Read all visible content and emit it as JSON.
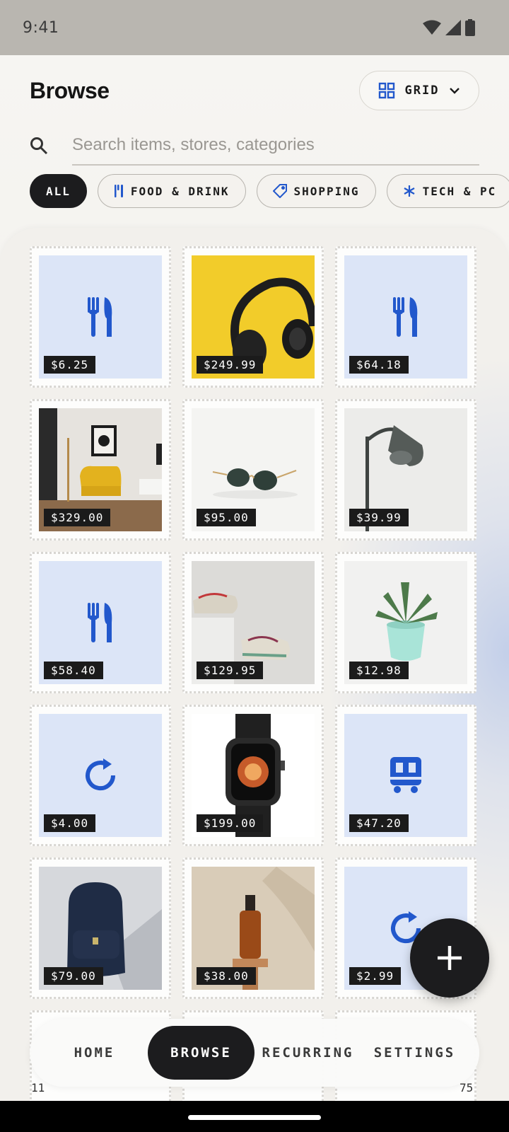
{
  "status_bar": {
    "time": "9:41"
  },
  "header": {
    "title": "Browse",
    "view_toggle_label": "GRID"
  },
  "search": {
    "placeholder": "Search items, stores, categories"
  },
  "chips": [
    {
      "label": "ALL",
      "icon": ""
    },
    {
      "label": "FOOD & DRINK",
      "icon": "fork-knife-icon"
    },
    {
      "label": "SHOPPING",
      "icon": "tag-icon"
    },
    {
      "label": "TECH & PC",
      "icon": "asterisk-icon"
    }
  ],
  "items": [
    {
      "price": "$6.25",
      "kind": "food"
    },
    {
      "price": "$249.99",
      "kind": "headphones"
    },
    {
      "price": "$64.18",
      "kind": "food"
    },
    {
      "price": "$329.00",
      "kind": "armchair"
    },
    {
      "price": "$95.00",
      "kind": "sunglasses"
    },
    {
      "price": "$39.99",
      "kind": "lamp"
    },
    {
      "price": "$58.40",
      "kind": "food"
    },
    {
      "price": "$129.95",
      "kind": "sneakers"
    },
    {
      "price": "$12.98",
      "kind": "plant"
    },
    {
      "price": "$4.00",
      "kind": "recurring"
    },
    {
      "price": "$199.00",
      "kind": "watch"
    },
    {
      "price": "$47.20",
      "kind": "transit"
    },
    {
      "price": "$79.00",
      "kind": "backpack"
    },
    {
      "price": "$38.00",
      "kind": "bottle"
    },
    {
      "price": "$2.99",
      "kind": "recurring"
    }
  ],
  "peek": {
    "left": "11",
    "right": "75"
  },
  "bottom_nav": {
    "home": "HOME",
    "browse": "BROWSE",
    "recurring": "RECURRING",
    "settings": "SETTINGS"
  },
  "colors": {
    "accent": "#2258cc",
    "dark": "#1c1c1e",
    "tile_blue": "#dce5f7"
  }
}
